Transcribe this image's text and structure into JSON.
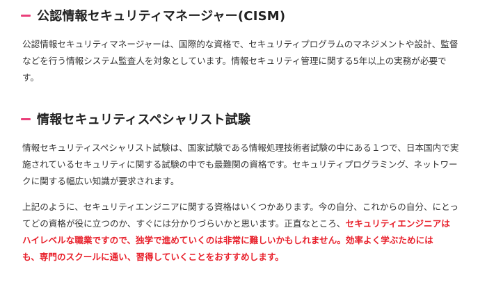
{
  "section1": {
    "heading": "公認情報セキュリティマネージャー(CISM)",
    "lines": [
      "公認情報セキュリティマネージャーは、国際的な資格で、セキュリティプログラムのマネジメントや設計、監督",
      "などを行う情報システム監査人を対象としています。情報セキュリティ管理に関する5年以上の実務が必要で",
      "す。"
    ]
  },
  "section2": {
    "heading": "情報セキュリティスペシャリスト試験",
    "para1_lines": [
      "情報セキュリティスペシャリスト試験は、国家試験である情報処理技術者試験の中にある１つで、日本国内で実",
      "施されているセキュリティに関する試験の中でも最難関の資格です。セキュリティプログラミング、ネットワー",
      "クに関する幅広い知識が要求されます。"
    ],
    "para2": {
      "line1": "上記のように、セキュリティエンジニアに関する資格はいくつかあります。今の自分、これからの自分、にとっ",
      "line2_plain": "てどの資格が役に立つのか、すぐには分かりづらいかと思います。正直なところ、",
      "line2_red": "セキュリティエンジニアは",
      "line3_red": "ハイレベルな職業ですので、独学で進めていくのは非常に難しいかもしれません。効率よく学ぶためには",
      "line4_red": "も、専門のスクールに通い、習得していくことをおすすめします。"
    }
  },
  "colors": {
    "accent_bar": "#ea3f7a",
    "emphasis_red": "#e8202b",
    "body_text": "#333333"
  }
}
